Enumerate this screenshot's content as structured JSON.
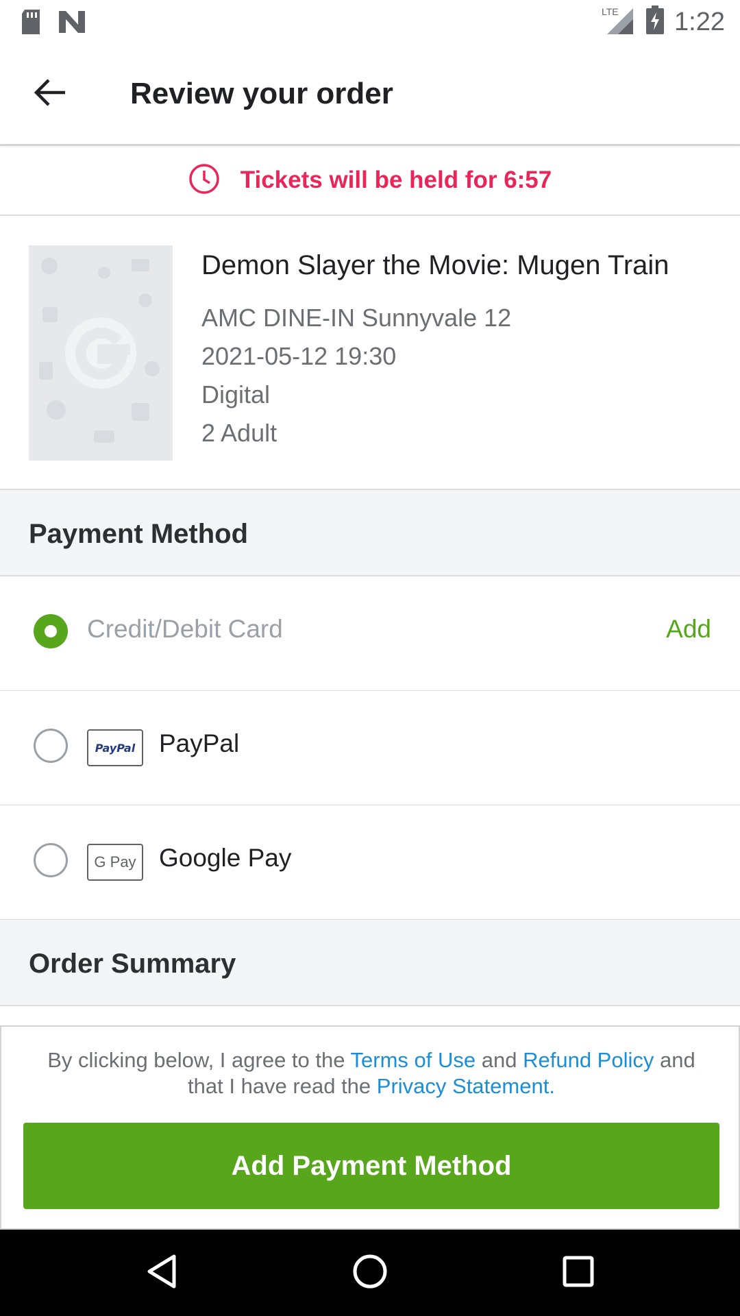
{
  "status_bar": {
    "time": "1:22",
    "network": "LTE",
    "icons": [
      "sd-card-icon",
      "n-logo-icon",
      "signal-icon",
      "battery-charging-icon"
    ]
  },
  "app_bar": {
    "title": "Review your order",
    "back_icon": "arrow-left-icon"
  },
  "hold_banner": {
    "text": "Tickets will be held for 6:57",
    "icon": "clock-icon",
    "color": "#e8265a"
  },
  "movie": {
    "title": "Demon Slayer the Movie: Mugen Train",
    "theater": "AMC DINE-IN Sunnyvale 12",
    "datetime": "2021-05-12 19:30",
    "format": "Digital",
    "tickets": "2 Adult",
    "poster_icon": "google-g-placeholder-icon"
  },
  "payment_method": {
    "header": "Payment Method",
    "options": [
      {
        "label": "Credit/Debit Card",
        "selected": true,
        "action": "Add"
      },
      {
        "label": "PayPal",
        "selected": false,
        "logo": "PayPal"
      },
      {
        "label": "Google Pay",
        "selected": false,
        "logo": "G Pay"
      }
    ]
  },
  "order_summary": {
    "header": "Order Summary"
  },
  "legal": {
    "prefix": "By clicking below, I agree to the ",
    "terms": "Terms of Use",
    "and1": " and ",
    "refund": "Refund Policy",
    "and2": " and that I have read the ",
    "privacy": "Privacy Statement",
    "suffix": "."
  },
  "cta": {
    "label": "Add Payment Method"
  },
  "colors": {
    "accent": "#57a61c",
    "hold": "#e8265a",
    "link": "#1a8ed6"
  },
  "nav_bar": {
    "icons": [
      "back-triangle-icon",
      "home-circle-icon",
      "recents-square-icon"
    ]
  }
}
